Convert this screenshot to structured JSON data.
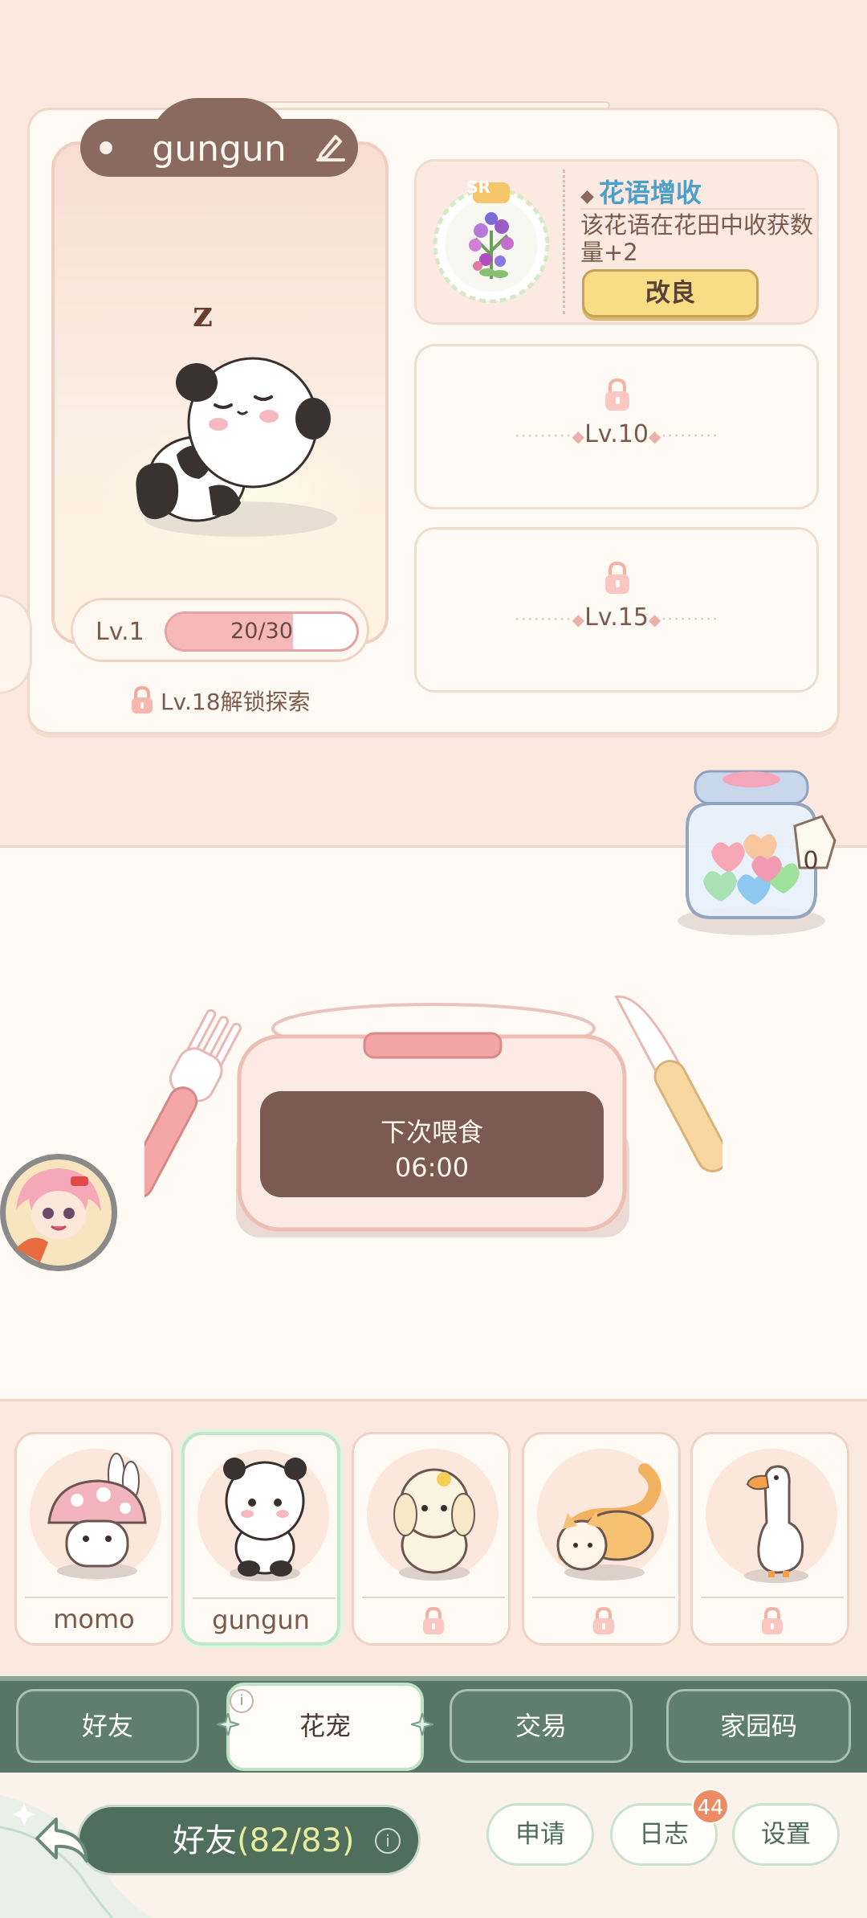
{
  "pet_card": {
    "name": "gungun",
    "level_label": "Lv.1",
    "xp_text": "20/30",
    "xp_progress": 0.667,
    "explore_unlock_text": "Lv.18解锁探索"
  },
  "skills": {
    "active": {
      "rarity": "SR",
      "title": "花语增收",
      "description": "该花语在花田中收获数量+2",
      "button_label": "改良"
    },
    "locked": [
      {
        "level": "Lv.10"
      },
      {
        "level": "Lv.15"
      }
    ]
  },
  "jar": {
    "count": "0"
  },
  "feed": {
    "title": "下次喂食",
    "time": "06:00"
  },
  "pets": [
    {
      "name": "momo",
      "locked": false,
      "selected": false
    },
    {
      "name": "gungun",
      "locked": false,
      "selected": true
    },
    {
      "name": "",
      "locked": true,
      "selected": false
    },
    {
      "name": "",
      "locked": true,
      "selected": false
    },
    {
      "name": "",
      "locked": true,
      "selected": false
    }
  ],
  "tabs": [
    {
      "label": "好友",
      "active": false
    },
    {
      "label": "花宠",
      "active": true
    },
    {
      "label": "交易",
      "active": false
    },
    {
      "label": "家园码",
      "active": false
    }
  ],
  "bottom": {
    "friends_label": "好友",
    "friends_count": "(82/83)",
    "buttons": {
      "apply": "申请",
      "log": "日志",
      "settings": "设置"
    },
    "log_badge": "44"
  },
  "colors": {
    "background": "#fbe9df",
    "tab_green": "#577665",
    "accent_blue": "#4aa0c8",
    "button_yellow": "#f8dd86",
    "badge_orange": "#ec8b63"
  }
}
